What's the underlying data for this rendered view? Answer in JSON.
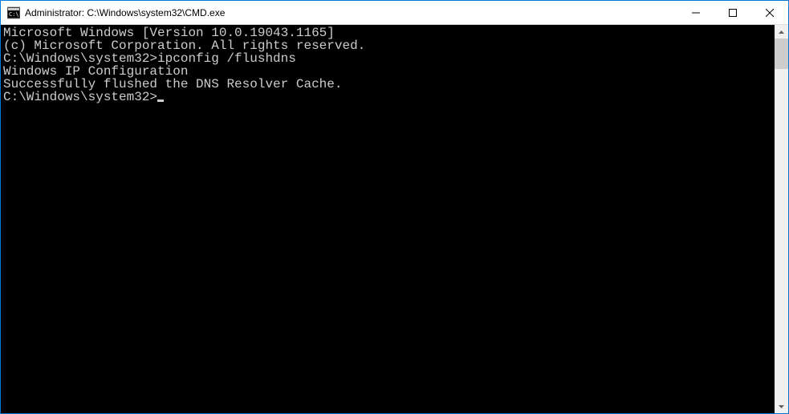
{
  "titlebar": {
    "title": "Administrator: C:\\Windows\\system32\\CMD.exe"
  },
  "terminal": {
    "line1": "Microsoft Windows [Version 10.0.19043.1165]",
    "line2": "(c) Microsoft Corporation. All rights reserved.",
    "blank1": "",
    "prompt1": "C:\\Windows\\system32>",
    "command1": "ipconfig /flushdns",
    "blank2": "",
    "line3": "Windows IP Configuration",
    "blank3": "",
    "line4": "Successfully flushed the DNS Resolver Cache.",
    "blank4": "",
    "prompt2": "C:\\Windows\\system32>"
  }
}
